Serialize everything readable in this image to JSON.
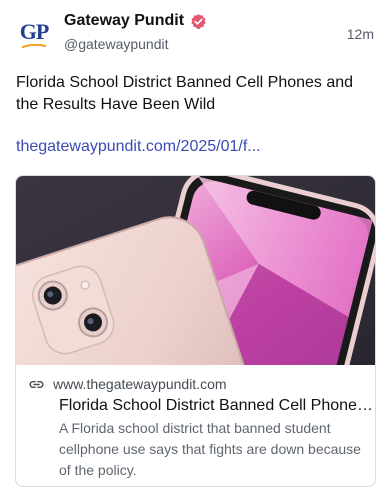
{
  "post": {
    "author_name": "Gateway Pundit",
    "author_handle": "@gatewaypundit",
    "timestamp": "12m",
    "avatar_text": "GP",
    "text": "Florida School District Banned Cell Phones and the Results Have Been Wild",
    "link_text": "thegatewaypundit.com/2025/01/f...",
    "verified_icon": "verified-badge-icon",
    "accent_color": "#3b4bb4"
  },
  "card": {
    "domain": "www.thegatewaypundit.com",
    "title": "Florida School District Banned Cell Phones and the Results Have Been Wild",
    "description": "A Florida school district that banned student cellphone use says that fights are down because of the policy.",
    "link_icon": "link-icon",
    "image_subject": "pink smartphone with dual cameras"
  }
}
